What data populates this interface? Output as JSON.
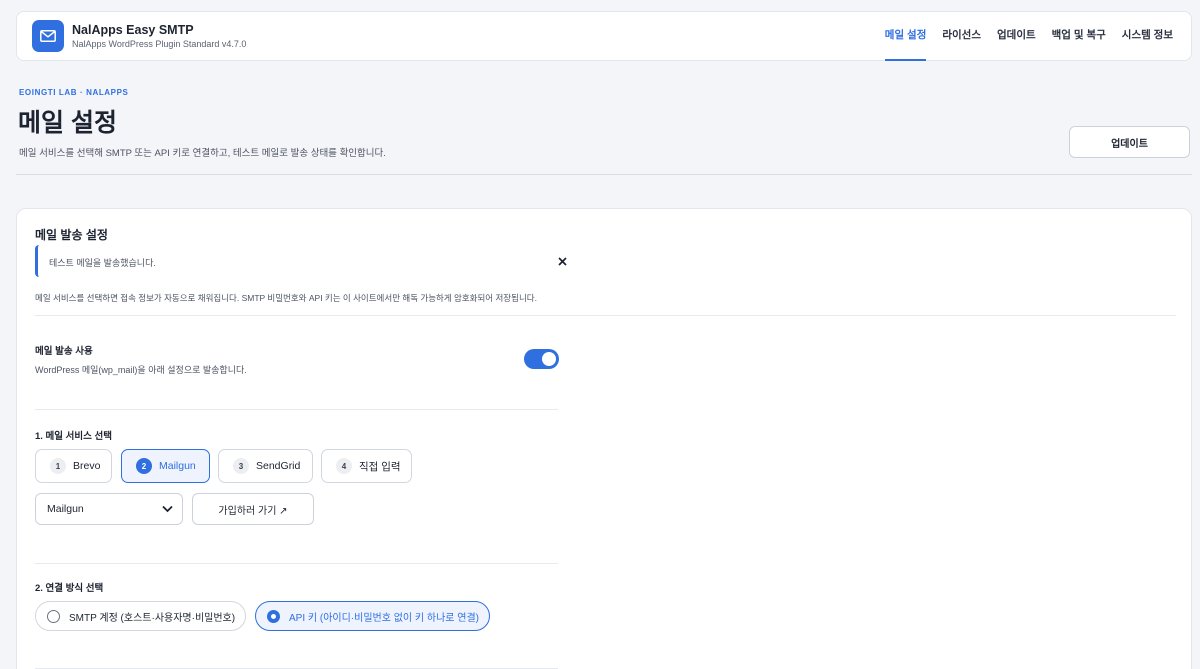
{
  "header": {
    "app_name": "NalApps Easy SMTP",
    "app_sub": "NalApps WordPress Plugin Standard v4.7.0",
    "nav": [
      {
        "label": "메일 설정",
        "active": true
      },
      {
        "label": "라이선스"
      },
      {
        "label": "업데이트"
      },
      {
        "label": "백업 및 복구"
      },
      {
        "label": "시스템 정보"
      }
    ]
  },
  "page": {
    "eyebrow": "EOINGTI LAB · NALAPPS",
    "title": "메일 설정",
    "description": "메일 서비스를 선택해 SMTP 또는 API 키로 연결하고, 테스트 메일로 발송 상태를 확인합니다.",
    "update_button": "업데이트"
  },
  "card": {
    "title": "메일 발송 설정",
    "notice": "테스트 메일을 발송했습니다.",
    "helper": "메일 서비스를 선택하면 접속 정보가 자동으로 채워집니다. SMTP 비밀번호와 API 키는 이 사이트에서만 해독 가능하게 암호화되어 저장됩니다.",
    "enable": {
      "label": "메일 발송 사용",
      "desc": "WordPress 메일(wp_mail)을 아래 설정으로 발송합니다.",
      "on": true
    },
    "service": {
      "label": "1. 메일 서비스 선택",
      "options": [
        {
          "num": "1",
          "label": "Brevo"
        },
        {
          "num": "2",
          "label": "Mailgun",
          "selected": true
        },
        {
          "num": "3",
          "label": "SendGrid"
        },
        {
          "num": "4",
          "label": "직접 입력"
        }
      ],
      "select_value": "Mailgun",
      "signup_label": "가입하러 가기 ↗"
    },
    "connection": {
      "label": "2. 연결 방식 선택",
      "options": [
        {
          "label": "SMTP 계정 (호스트·사용자명·비밀번호)"
        },
        {
          "label": "API 키 (아이디·비밀번호 없이 키 하나로 연결)",
          "selected": true
        }
      ]
    }
  },
  "colors": {
    "accent": "#2f6fe0",
    "background": "#f4f5f8"
  }
}
